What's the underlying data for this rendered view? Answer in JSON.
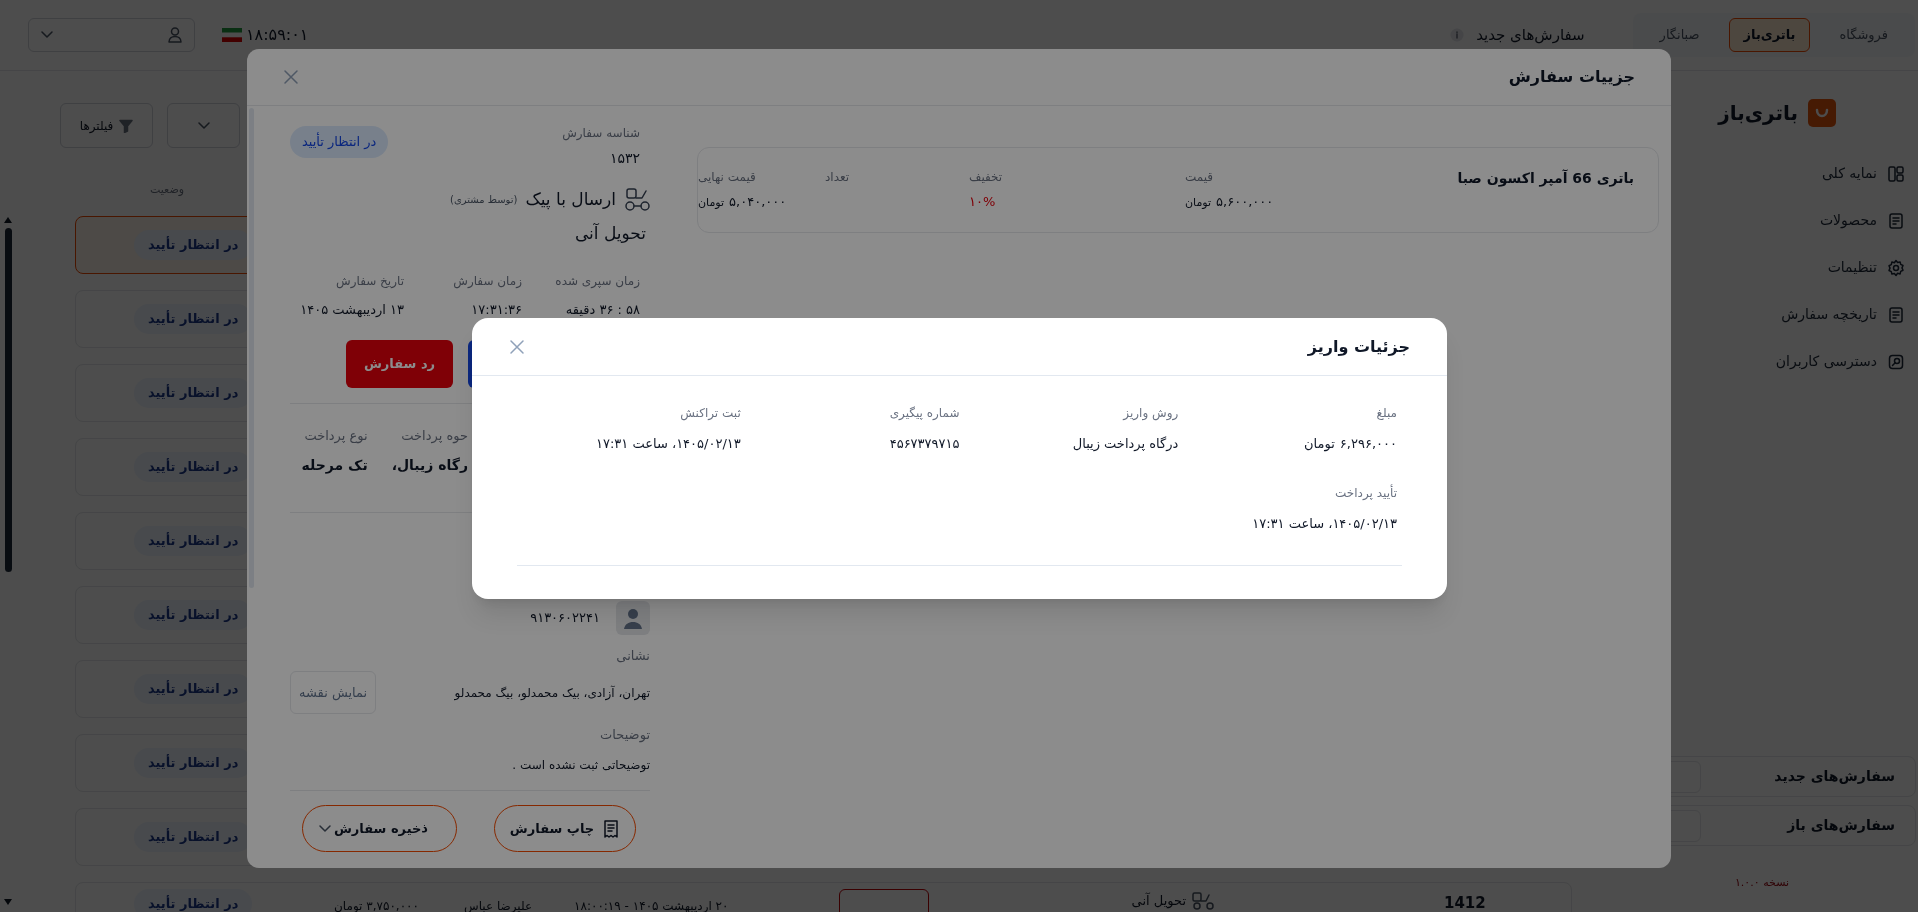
{
  "header": {
    "top_tabs": [
      {
        "label": "فروشگاه",
        "selected": false
      },
      {
        "label": "باتری‌باز",
        "selected": true
      },
      {
        "label": "صبانگار",
        "selected": false
      }
    ],
    "title": "سفارش‌های جدید",
    "clock": "۱۸:۵۹:۰۱"
  },
  "sidebar": {
    "brand": "باتری‌باز",
    "items": [
      {
        "label": "نمایه کلی"
      },
      {
        "label": "محصولات"
      },
      {
        "label": "تنظیمات"
      },
      {
        "label": "تاریخچه سفارش"
      },
      {
        "label": "دسترسی کاربران"
      }
    ],
    "summary": [
      {
        "label": "سفارش‌های جدید"
      },
      {
        "label": "سفارش‌های باز"
      }
    ],
    "version": "نسخه ۱.۰.۰"
  },
  "filters": {
    "label": "فیلترها"
  },
  "list": {
    "column": "وضعیت",
    "rows": [
      {
        "status": "در انتظار تأیید",
        "selected": true
      },
      {
        "status": "در انتظار تأیید",
        "selected": false
      },
      {
        "status": "در انتظار تأیید",
        "selected": false
      },
      {
        "status": "در انتظار تأیید",
        "selected": false
      },
      {
        "status": "در انتظار تأیید",
        "selected": false
      },
      {
        "status": "در انتظار تأیید",
        "selected": false
      },
      {
        "status": "در انتظار تأیید",
        "selected": false
      },
      {
        "status": "در انتظار تأیید",
        "selected": false
      },
      {
        "status": "در انتظار تأیید",
        "selected": false
      },
      {
        "status": "در انتظار تأیید",
        "selected": false,
        "amount": "۳,۷۵۰,۰۰۰ تومان",
        "customer": "علیرضا عباس",
        "date": "۲۰ اردیبهشت ۱۴۰۵ - ۱۸:۰۰:۱۹",
        "delivery": "تحویل آنی",
        "id": "1412"
      }
    ]
  },
  "order_modal": {
    "title": "جزییات سفارش",
    "product": {
      "name": "باتری 66 آمپر اکسون صبا",
      "fields": [
        {
          "label": "قیمت",
          "value": "۵,۶۰۰,۰۰۰",
          "unit": "تومان",
          "kind": "price"
        },
        {
          "label": "تخفیف",
          "value": "۱۰%",
          "kind": "discount"
        },
        {
          "label": "تعداد"
        },
        {
          "label": "قیمت نهایی",
          "value": "۵,۰۴۰,۰۰۰",
          "unit": "تومان",
          "kind": "price"
        }
      ]
    },
    "order_id_label": "شناسه سفارش",
    "order_id": "۱۵۳۲",
    "status": "در انتظار تأیید",
    "shipping": {
      "method": "ارسال با پیک",
      "note": "(توسط مشتری)",
      "delivery": "تحویل آنی"
    },
    "times": [
      {
        "label": "زمان سپری شده",
        "value": "۵۸ : ۳۶ دقیقه"
      },
      {
        "label": "زمان سفارش",
        "value": "۱۷:۳۱:۳۶"
      },
      {
        "label": "تاریخ سفارش",
        "value": "۱۳ اردیبهشت ۱۴۰۵"
      }
    ],
    "reject_button": "رد سفارش",
    "payment": [
      {
        "label": "حوه پرداخت",
        "value": "رگاه زیبال،"
      },
      {
        "label": "نوع پرداخت",
        "value": "تک مرحله"
      }
    ],
    "phone": "۹۱۳۰۶۰۲۲۴۱",
    "address_label": "نشانی",
    "address": "تهران، آزادی، بیک محمدلو، بیگ محمدلو",
    "map_button": "نمایش نقشه",
    "notes_label": "توضیحات",
    "notes": "توضیحاتی ثبت نشده است .",
    "print_button": "چاپ سفارش",
    "save_button": "ذخیره سفارش"
  },
  "payment_modal": {
    "title": "جزئیات واریز",
    "fields": [
      {
        "label": "مبلغ",
        "value": "۶,۲۹۶,۰۰۰",
        "unit": "تومان"
      },
      {
        "label": "روش واریز",
        "value": "درگاه پرداخت زیبال"
      },
      {
        "label": "شماره پیگیری",
        "value": "۴۵۶۷۳۷۹۷۱۵"
      },
      {
        "label": "ثبت تراکنش",
        "value": "۱۴۰۵/۰۲/۱۳، ساعت ۱۷:۳۱"
      },
      {
        "label": "تأیید پرداخت",
        "value": "۱۴۰۵/۰۲/۱۳، ساعت ۱۷:۳۱"
      }
    ]
  }
}
